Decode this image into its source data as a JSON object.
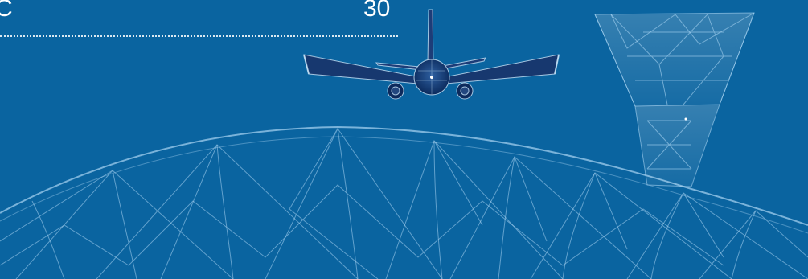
{
  "row": {
    "label": "C",
    "value": "30"
  },
  "illustration": {
    "background_color": "#0a64a0",
    "line_color": "#a9d4f2",
    "icons": [
      "airplane-icon",
      "control-tower-icon",
      "terminal-roof-icon"
    ]
  }
}
